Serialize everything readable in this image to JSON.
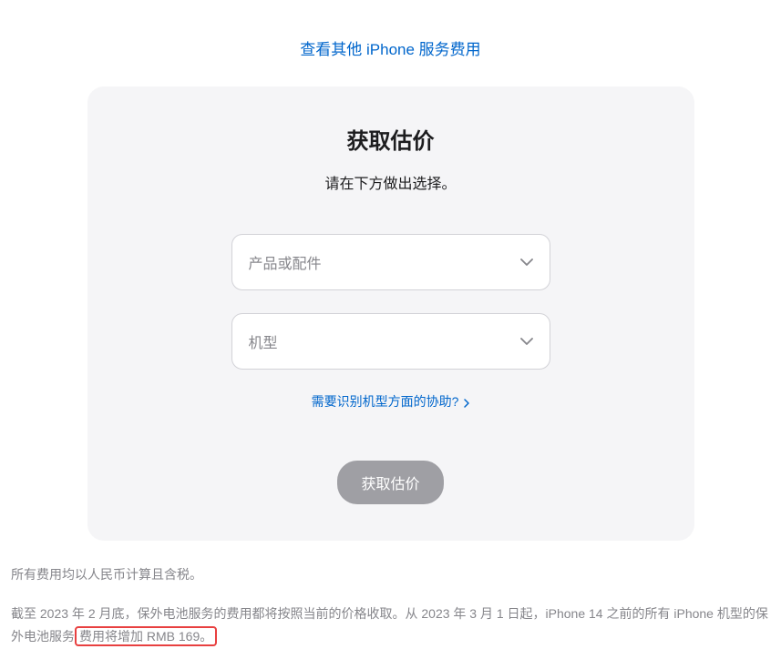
{
  "topLink": {
    "label": "查看其他 iPhone 服务费用"
  },
  "card": {
    "title": "获取估价",
    "subtitle": "请在下方做出选择。",
    "selects": {
      "product": {
        "placeholder": "产品或配件"
      },
      "model": {
        "placeholder": "机型"
      }
    },
    "helpLink": {
      "label": "需要识别机型方面的协助?"
    },
    "submitButton": {
      "label": "获取估价"
    }
  },
  "footer": {
    "line1": "所有费用均以人民币计算且含税。",
    "line2_part1": "截至 2023 年 2 月底，保外电池服务的费用都将按照当前的价格收取。从 2023 年 3 月 1 日起，iPhone 14 之前的所有 iPhone 机型的保外电池服务",
    "line2_highlighted": "费用将增加 RMB 169。"
  }
}
